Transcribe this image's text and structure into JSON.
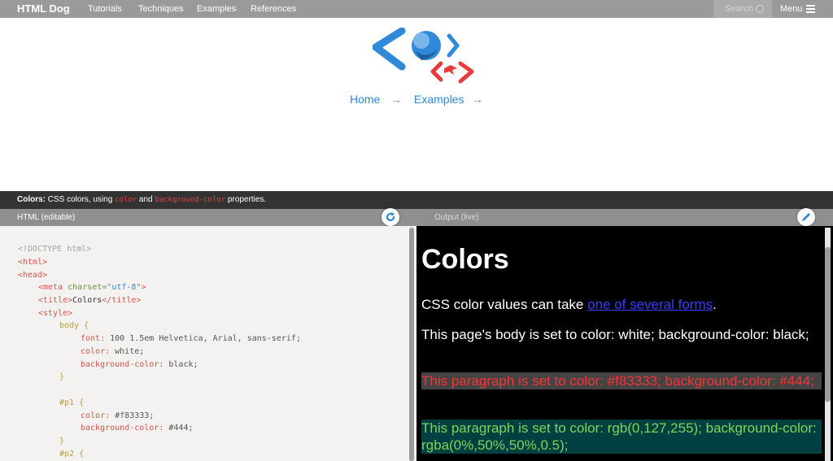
{
  "nav": {
    "brand": "HTML Dog",
    "links": [
      "Tutorials",
      "Techniques",
      "Examples",
      "References"
    ],
    "search_label": "Search",
    "menu_label": "Menu"
  },
  "breadcrumb": {
    "home": "Home",
    "examples": "Examples",
    "arrow": "→"
  },
  "description": {
    "title": "Colors:",
    "text_a": " CSS colors, using ",
    "code1": "color",
    "text_b": " and ",
    "code2": "background-color",
    "text_c": " properties."
  },
  "panels": {
    "left_title": "HTML (editable)",
    "right_title": "Output (live)"
  },
  "code": {
    "l1": "<!DOCTYPE html>",
    "l2_tag": "<html>",
    "l3_tag": "<head>",
    "l4_open": "<meta",
    "l4_attr": " charset=",
    "l4_str": "\"utf-8\"",
    "l4_close": ">",
    "l5_open": "<title>",
    "l5_text": "Colors",
    "l5_close": "</title>",
    "l6_tag": "<style>",
    "l7": "body {",
    "l8_prop": "font:",
    "l8_val": " 100 1.5em Helvetica, Arial, sans-serif;",
    "l9_prop": "color:",
    "l9_val": " white;",
    "l10_prop": "background-color:",
    "l10_val": " black;",
    "l11": "}",
    "l13": "#p1 {",
    "l14_prop": "color:",
    "l14_val": " #f83333;",
    "l15_prop": "background-color:",
    "l15_val": " #444;",
    "l16": "}",
    "l17": "#p2 {"
  },
  "output": {
    "heading": "Colors",
    "p_intro_a": "CSS color values can take ",
    "p_intro_link": "one of several forms",
    "p_intro_b": ".",
    "p_body": "This page's body is set to color: white; background-color: black;",
    "p1": "This paragraph is set to color: #f83333; background-color: #444;",
    "p2": "This paragraph is set to color: rgb(0,127,255); background-color: rgba(0%,50%,50%,0.5);"
  },
  "colors": {
    "nav_bg": "#9a9a9a",
    "link": "#2f88d8",
    "desc_bg": "#333333",
    "panel_header_bg": "#8f8f8f",
    "editor_bg": "#f4f2f0",
    "output_bg": "#000000",
    "p1_color": "#f83333",
    "p1_bg": "#444444"
  },
  "icons": {
    "logo": "html-dog-logo",
    "refresh": "refresh-icon",
    "edit": "pencil-icon",
    "search": "search-icon",
    "menu": "hamburger-menu-icon"
  }
}
